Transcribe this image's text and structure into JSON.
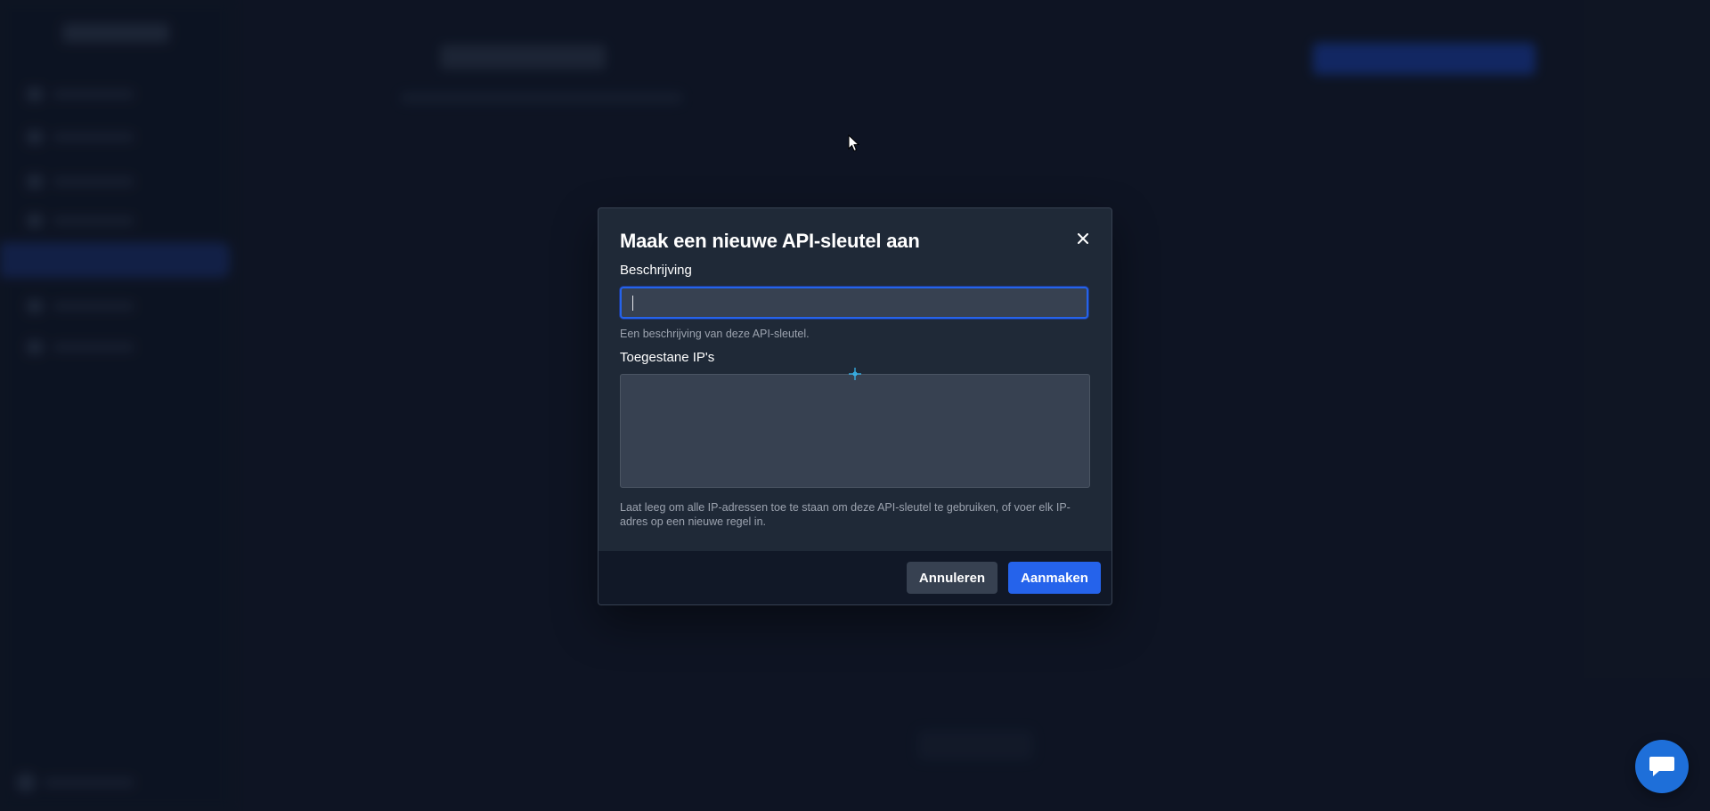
{
  "modal": {
    "title": "Maak een nieuwe API-sleutel aan",
    "description_label": "Beschrijving",
    "description_value": "",
    "description_help": "Een beschrijving van deze API-sleutel.",
    "allowed_ips_label": "Toegestane IP's",
    "allowed_ips_value": "",
    "allowed_ips_help": "Laat leeg om alle IP-adressen toe te staan om deze API-sleutel te gebruiken, of voer elk IP-adres op een nieuwe regel in.",
    "cancel_label": "Annuleren",
    "create_label": "Aanmaken"
  },
  "icons": {
    "close": "close-icon",
    "chat": "chat-icon",
    "pointer": "mouse-pointer-icon",
    "move": "move-cursor-icon"
  },
  "colors": {
    "background": "#111827",
    "modal": "#1f2937",
    "input": "#374151",
    "primary": "#2563eb",
    "footer": "#111827",
    "help_text": "#9ca3af",
    "chat_button": "#1e6fd9"
  }
}
